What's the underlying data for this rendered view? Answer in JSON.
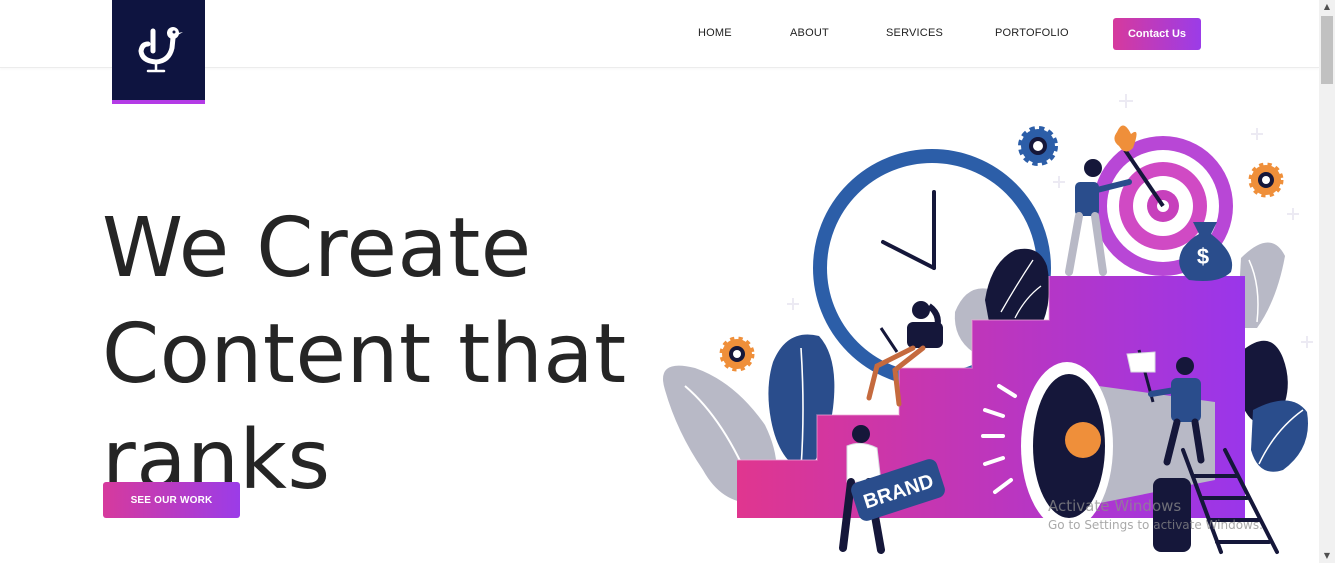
{
  "nav": {
    "logo_icon": "duck-icon",
    "items": [
      {
        "label": "HOME"
      },
      {
        "label": "ABOUT"
      },
      {
        "label": "SERVICES"
      },
      {
        "label": "PORTOFOLIO"
      }
    ],
    "contact_label": "Contact Us"
  },
  "hero": {
    "title_lines": [
      "We Create",
      "Content that",
      "ranks"
    ],
    "cta_label": "SEE OUR WORK",
    "illustration": {
      "brand_sign": "BRAND",
      "money_symbol": "$"
    }
  },
  "overlay": {
    "line1": "Activate Windows",
    "line2": "Go to Settings to activate Windows."
  },
  "colors": {
    "navy": "#0e1440",
    "gradient_start": "#d63a9d",
    "gradient_end": "#9b3ce8",
    "clock_blue": "#2c5ea8",
    "text": "#252525"
  }
}
